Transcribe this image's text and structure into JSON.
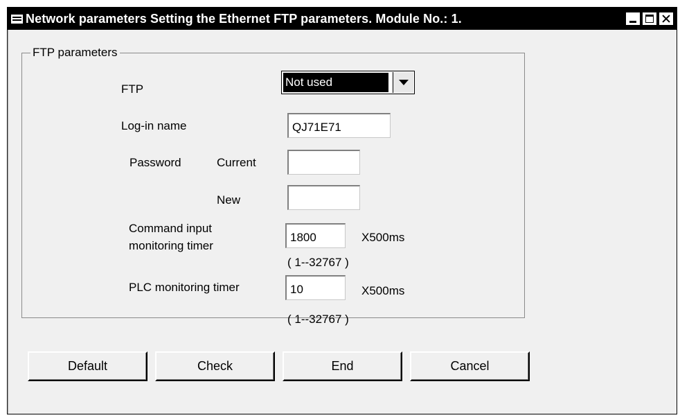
{
  "window": {
    "title": "Network parameters  Setting the Ethernet FTP parameters.  Module No.: 1."
  },
  "group": {
    "label": "FTP parameters"
  },
  "ftp": {
    "label": "FTP",
    "selected": "Not used"
  },
  "login": {
    "label": "Log-in name",
    "value": "QJ71E71"
  },
  "password": {
    "label": "Password",
    "current_label": "Current",
    "current_value": "",
    "new_label": "New",
    "new_value": ""
  },
  "command_timer": {
    "label_line1": "Command input",
    "label_line2": "monitoring timer",
    "value": "1800",
    "unit": "X500ms",
    "range": "( 1--32767 )"
  },
  "plc_timer": {
    "label": "PLC monitoring timer",
    "value": "10",
    "unit": "X500ms",
    "range": "( 1--32767 )"
  },
  "buttons": {
    "default": "Default",
    "check": "Check",
    "end": "End",
    "cancel": "Cancel"
  }
}
